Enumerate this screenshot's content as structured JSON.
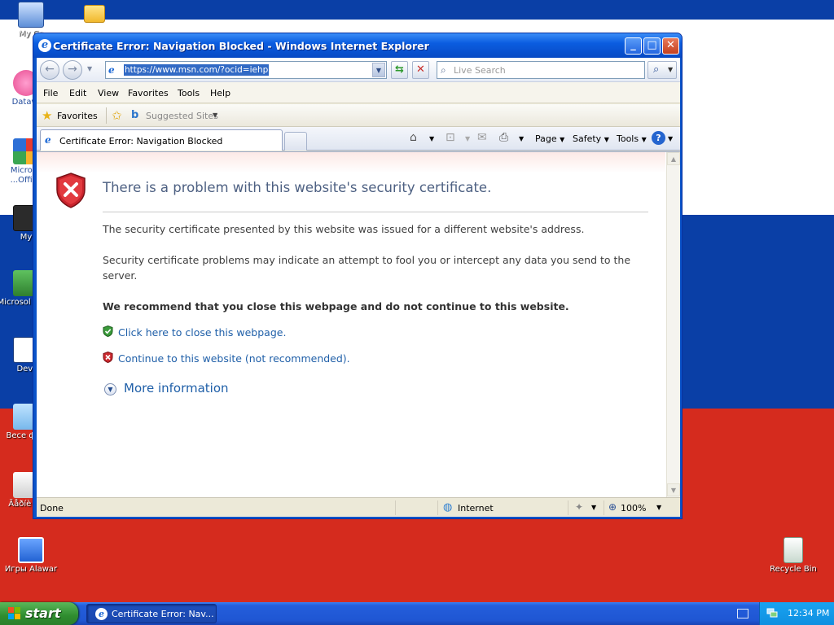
{
  "desktop": {
    "icons": [
      {
        "label": "My Co"
      },
      {
        "label": ""
      },
      {
        "label": "Datawi"
      },
      {
        "label": "Microso ...Office"
      },
      {
        "label": "My"
      },
      {
        "label": "Microsol Basic"
      },
      {
        "label": "Dev-"
      },
      {
        "label": "Весе фер"
      },
      {
        "label": "Äåðíè åé"
      },
      {
        "label": "Игры Alawar"
      },
      {
        "label": "Recycle Bin"
      }
    ]
  },
  "window": {
    "title": "Certificate Error: Navigation Blocked - Windows Internet Explorer",
    "address": {
      "url": "https://www.msn.com/?ocid=iehp"
    },
    "search": {
      "placeholder": "Live Search"
    },
    "menu": [
      "File",
      "Edit",
      "View",
      "Favorites",
      "Tools",
      "Help"
    ],
    "favorites_bar": {
      "favorites_label": "Favorites",
      "suggested_label": "Suggested Sites"
    },
    "tab": {
      "label": "Certificate Error: Navigation Blocked"
    },
    "commands": {
      "page": "Page",
      "safety": "Safety",
      "tools": "Tools"
    },
    "content": {
      "heading": "There is a problem with this website's security certificate.",
      "para1": "The security certificate presented by this website was issued for a different website's address.",
      "para2": "Security certificate problems may indicate an attempt to fool you or intercept any data you send to the server.",
      "recommend": "We recommend that you close this webpage and do not continue to this website.",
      "close_link": "Click here to close this webpage.",
      "continue_link": "Continue to this website (not recommended).",
      "more_info": "More information"
    },
    "status": {
      "text": "Done",
      "zone": "Internet",
      "zoom": "100%"
    }
  },
  "taskbar": {
    "start_label": "start",
    "task_label": "Certificate Error: Nav...",
    "clock": "12:34 PM"
  }
}
